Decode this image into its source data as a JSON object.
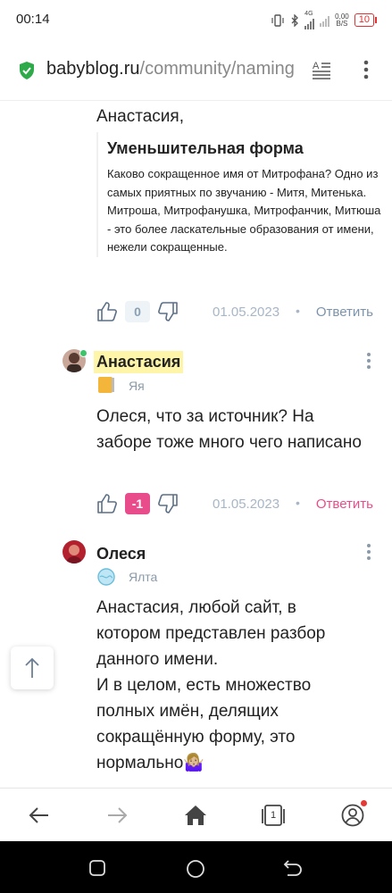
{
  "status": {
    "time": "00:14",
    "net_type": "4G",
    "speed_value": "0,00",
    "speed_unit": "B/S",
    "battery": "10"
  },
  "browser": {
    "url_host": "babyblog.ru",
    "url_path": "/community/naming"
  },
  "post": {
    "author_line": "Анастасия,",
    "quote_title": "Уменьшительная форма",
    "quote_text": "Каково сокращенное имя от Митрофана? Одно из самых приятных по звучанию - Митя, Митенька. Митроша, Митрофанушка, Митрофанчик, Митюша - это более ласкательные образования от имени, нежели сокращенные.",
    "likes": "0",
    "date": "01.05.2023",
    "dot": "•",
    "reply": "Ответить"
  },
  "comments": [
    {
      "name": "Анастасия",
      "city": "Яя",
      "text": "Олеся, что за источник? На заборе тоже много чего написано",
      "likes": "-1",
      "date": "01.05.2023",
      "dot": "•",
      "reply": "Ответить"
    },
    {
      "name": "Олеся",
      "city": "Ялта",
      "text": "Анастасия, любой сайт, в котором представлен разбор данного имени.\nИ в целом, есть множество полных имён, делящих сокращённую форму, это нормально🤷🏼‍♀️"
    }
  ],
  "bottombar": {
    "tab_count": "1"
  },
  "colors": {
    "accent_pink": "#e84c8b",
    "link_blue": "#7c93ab",
    "highlight": "#fff5a8",
    "online": "#3cc46a"
  }
}
